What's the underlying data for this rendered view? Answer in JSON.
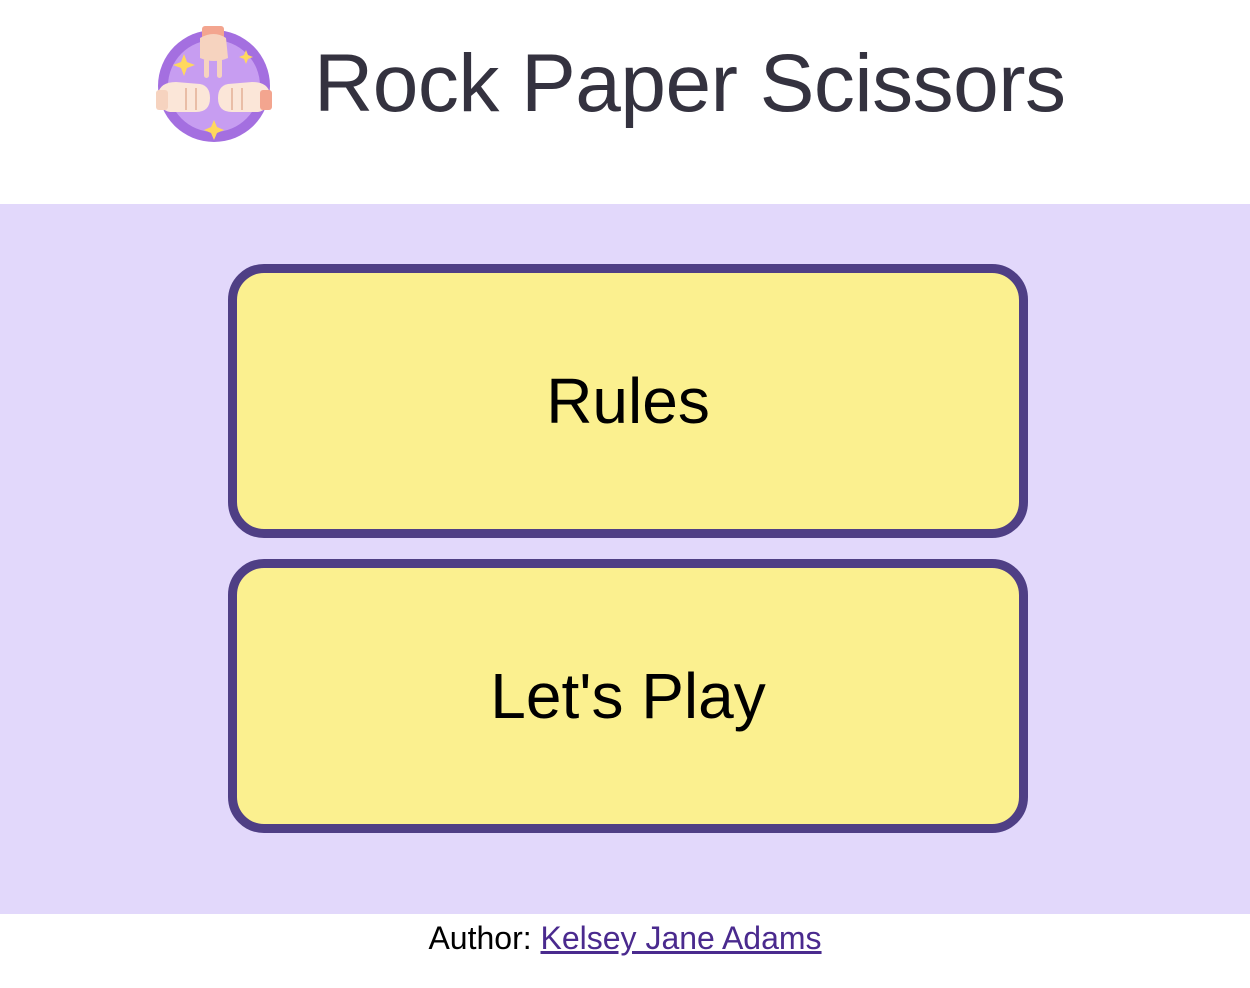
{
  "header": {
    "title": "Rock Paper Scissors",
    "logo_icon": "rock-paper-scissors-hands-icon"
  },
  "menu": {
    "rules_label": "Rules",
    "play_label": "Let's Play"
  },
  "footer": {
    "author_prefix": "Author: ",
    "author_name": "Kelsey Jane Adams"
  },
  "colors": {
    "main_background": "#e2d8fb",
    "button_fill": "#fbf08f",
    "button_border": "#4f3f85",
    "title_text": "#34323f",
    "link": "#4a2a8e"
  }
}
